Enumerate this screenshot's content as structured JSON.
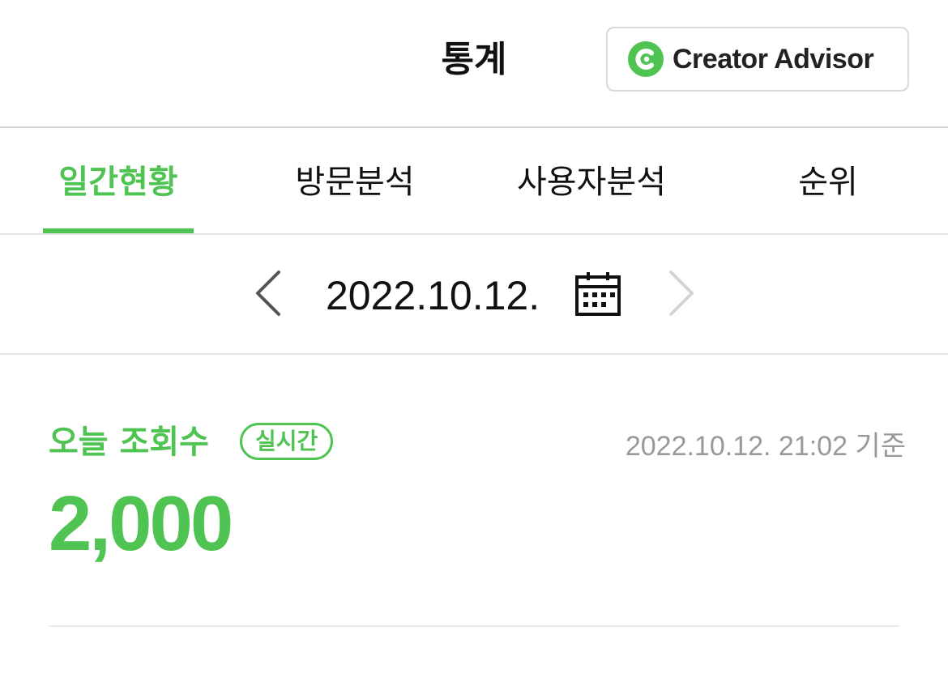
{
  "header": {
    "title": "통계",
    "creator_advisor_label": "Creator Advisor",
    "logo_icon": "creator-advisor-logo-icon",
    "brand_color": "#4fc452"
  },
  "tabs": [
    {
      "label": "일간현황",
      "active": true
    },
    {
      "label": "방문분석",
      "active": false
    },
    {
      "label": "사용자분석",
      "active": false
    },
    {
      "label": "순위",
      "active": false
    }
  ],
  "date_nav": {
    "date": "2022.10.12.",
    "prev_icon": "chevron-left-icon",
    "next_icon": "chevron-right-icon",
    "next_disabled": true,
    "calendar_icon": "calendar-icon"
  },
  "today_stats": {
    "title": "오늘 조회수",
    "badge": "실시간",
    "timestamp": "2022.10.12. 21:02 기준",
    "count": "2,000"
  },
  "colors": {
    "accent": "#4fc452",
    "muted_text": "#999999",
    "border": "#d6d6d6"
  }
}
